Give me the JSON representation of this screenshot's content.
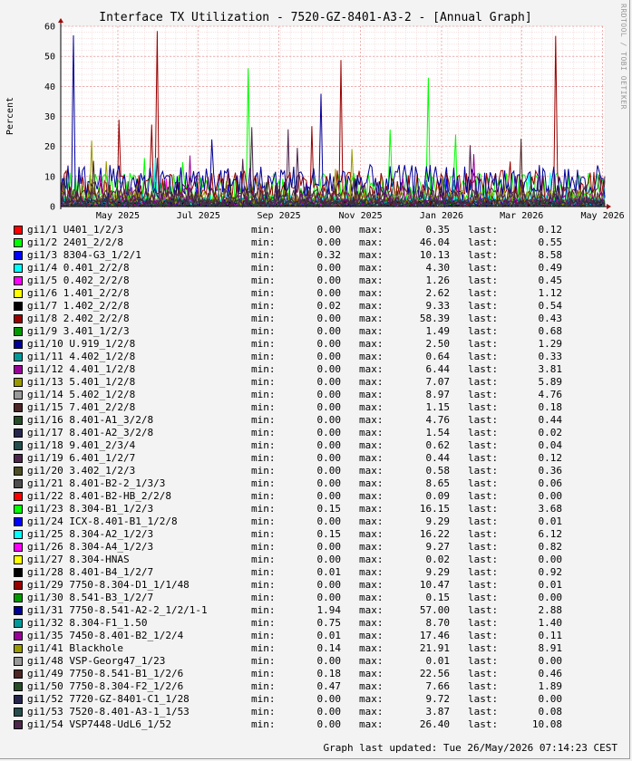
{
  "chart_data": {
    "type": "line",
    "title": "Interface TX Utilization - 7520-GZ-8401-A3-2 - [Annual Graph]",
    "ylabel": "Percent",
    "xlabel": "",
    "ylim": [
      0,
      60
    ],
    "yticks": [
      0,
      10,
      20,
      30,
      40,
      50,
      60
    ],
    "xticks": [
      "May 2025",
      "Jul 2025",
      "Sep 2025",
      "Nov 2025",
      "Jan 2026",
      "Mar 2026",
      "May 2026"
    ],
    "grid": true,
    "legend_position": "bottom"
  },
  "legend_labels": {
    "min": "min:",
    "max": "max:",
    "last": "last:"
  },
  "series": [
    {
      "name": "gi1/1 U401_1/2/3",
      "color": "#ff0000",
      "min": "0.00",
      "max": "0.35",
      "last": "0.12"
    },
    {
      "name": "gi1/2 2401_2/2/8",
      "color": "#00ff00",
      "min": "0.00",
      "max": "46.04",
      "last": "0.55"
    },
    {
      "name": "gi1/3 8304-G3_1/2/1",
      "color": "#0000ff",
      "min": "0.32",
      "max": "10.13",
      "last": "8.58"
    },
    {
      "name": "gi1/4 0.401_2/2/8",
      "color": "#00ffff",
      "min": "0.00",
      "max": "4.30",
      "last": "0.49"
    },
    {
      "name": "gi1/5 0.402_2/2/8",
      "color": "#ff00ff",
      "min": "0.00",
      "max": "1.26",
      "last": "0.45"
    },
    {
      "name": "gi1/6 1.401_2/2/8",
      "color": "#ffff00",
      "min": "0.00",
      "max": "2.62",
      "last": "1.12"
    },
    {
      "name": "gi1/7 1.402_2/2/8",
      "color": "#000000",
      "min": "0.02",
      "max": "9.33",
      "last": "0.54"
    },
    {
      "name": "gi1/8 2.402_2/2/8",
      "color": "#990000",
      "min": "0.00",
      "max": "58.39",
      "last": "0.43"
    },
    {
      "name": "gi1/9 3.401_1/2/3",
      "color": "#009900",
      "min": "0.00",
      "max": "1.49",
      "last": "0.68"
    },
    {
      "name": "gi1/10 U.919_1/2/8",
      "color": "#000099",
      "min": "0.00",
      "max": "2.50",
      "last": "1.29"
    },
    {
      "name": "gi1/11 4.402_1/2/8",
      "color": "#009999",
      "min": "0.00",
      "max": "0.64",
      "last": "0.33"
    },
    {
      "name": "gi1/12 4.401_1/2/8",
      "color": "#990099",
      "min": "0.00",
      "max": "6.44",
      "last": "3.81"
    },
    {
      "name": "gi1/13 5.401_1/2/8",
      "color": "#999900",
      "min": "0.00",
      "max": "7.07",
      "last": "5.89"
    },
    {
      "name": "gi1/14 5.402_1/2/8",
      "color": "#999999",
      "min": "0.00",
      "max": "8.97",
      "last": "4.76"
    },
    {
      "name": "gi1/15 7.401_2/2/8",
      "color": "#4d2626",
      "min": "0.00",
      "max": "1.15",
      "last": "0.18"
    },
    {
      "name": "gi1/16 8.401-A1_3/2/8",
      "color": "#264d26",
      "min": "0.00",
      "max": "4.76",
      "last": "0.44"
    },
    {
      "name": "gi1/17 8.401-A2_3/2/8",
      "color": "#26264d",
      "min": "0.00",
      "max": "1.54",
      "last": "0.02"
    },
    {
      "name": "gi1/18 9.401_2/3/4",
      "color": "#264d4d",
      "min": "0.00",
      "max": "0.62",
      "last": "0.04"
    },
    {
      "name": "gi1/19 6.401_1/2/7",
      "color": "#4d264d",
      "min": "0.00",
      "max": "0.44",
      "last": "0.12"
    },
    {
      "name": "gi1/20 3.402_1/2/3",
      "color": "#4d4d26",
      "min": "0.00",
      "max": "0.58",
      "last": "0.36"
    },
    {
      "name": "gi1/21 8.401-B2-2_1/3/3",
      "color": "#4d4d4d",
      "min": "0.00",
      "max": "8.65",
      "last": "0.06"
    },
    {
      "name": "gi1/22 8.401-B2-HB_2/2/8",
      "color": "#ff0000",
      "min": "0.00",
      "max": "0.09",
      "last": "0.00"
    },
    {
      "name": "gi1/23 8.304-B1_1/2/3",
      "color": "#00ff00",
      "min": "0.15",
      "max": "16.15",
      "last": "3.68"
    },
    {
      "name": "gi1/24 ICX-8.401-B1_1/2/8",
      "color": "#0000ff",
      "min": "0.00",
      "max": "9.29",
      "last": "0.01"
    },
    {
      "name": "gi1/25 8.304-A2_1/2/3",
      "color": "#00ffff",
      "min": "0.15",
      "max": "16.22",
      "last": "6.12"
    },
    {
      "name": "gi1/26 8.304-A4_1/2/3",
      "color": "#ff00ff",
      "min": "0.00",
      "max": "9.27",
      "last": "0.82"
    },
    {
      "name": "gi1/27 8.304-HNAS",
      "color": "#ffff00",
      "min": "0.00",
      "max": "0.02",
      "last": "0.00"
    },
    {
      "name": "gi1/28 8.401-B4_1/2/7",
      "color": "#000000",
      "min": "0.01",
      "max": "9.29",
      "last": "0.92"
    },
    {
      "name": "gi1/29 7750-8.304-D1_1/1/48",
      "color": "#990000",
      "min": "0.00",
      "max": "10.47",
      "last": "0.01"
    },
    {
      "name": "gi1/30 8.541-B3_1/2/7",
      "color": "#009900",
      "min": "0.00",
      "max": "0.15",
      "last": "0.00"
    },
    {
      "name": "gi1/31 7750-8.541-A2-2_1/2/1-1",
      "color": "#000099",
      "min": "1.94",
      "max": "57.00",
      "last": "2.88"
    },
    {
      "name": "gi1/32 8.304-F1_1.50",
      "color": "#009999",
      "min": "0.75",
      "max": "8.70",
      "last": "1.40"
    },
    {
      "name": "gi1/35 7450-8.401-B2_1/2/4",
      "color": "#990099",
      "min": "0.01",
      "max": "17.46",
      "last": "0.11"
    },
    {
      "name": "gi1/41 Blackhole",
      "color": "#999900",
      "min": "0.14",
      "max": "21.91",
      "last": "8.91"
    },
    {
      "name": "gi1/48 VSP-Georg47_1/23",
      "color": "#999999",
      "min": "0.00",
      "max": "0.01",
      "last": "0.00"
    },
    {
      "name": "gi1/49 7750-8.541-B1_1/2/6",
      "color": "#4d2626",
      "min": "0.18",
      "max": "22.56",
      "last": "0.46"
    },
    {
      "name": "gi1/50 7750-8.304-F2_1/2/6",
      "color": "#264d26",
      "min": "0.47",
      "max": "7.66",
      "last": "1.89"
    },
    {
      "name": "gi1/52 7720-GZ-8401-C1_1/28",
      "color": "#26264d",
      "min": "0.00",
      "max": "9.72",
      "last": "0.00"
    },
    {
      "name": "gi1/53 7520-8.401-A3-1_1/53",
      "color": "#264d4d",
      "min": "0.00",
      "max": "3.87",
      "last": "0.08"
    },
    {
      "name": "gi1/54 VSP7448-UdL6_1/52",
      "color": "#4d264d",
      "min": "0.00",
      "max": "26.40",
      "last": "10.08"
    }
  ],
  "footer": "Graph last updated: Tue 26/May/2026 07:14:23 CEST",
  "side_label": "RRDTOOL / TOBI OETIKER"
}
